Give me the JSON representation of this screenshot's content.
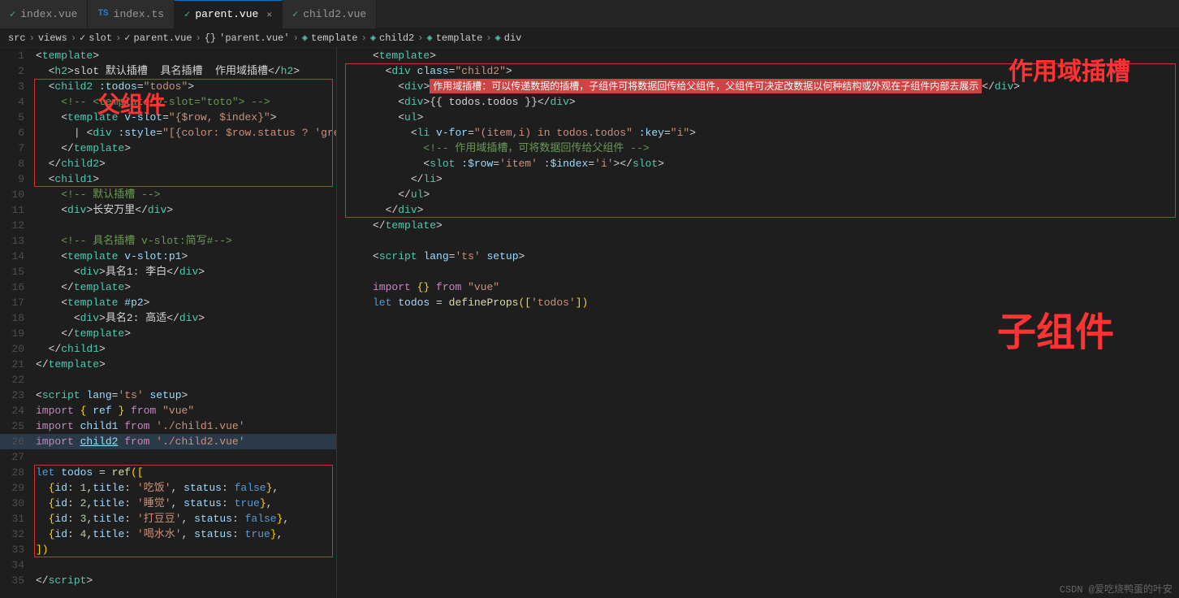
{
  "tabs": [
    {
      "id": "index-vue",
      "label": "index.vue",
      "type": "vue",
      "active": false
    },
    {
      "id": "index-ts",
      "label": "index.ts",
      "type": "ts",
      "active": false
    },
    {
      "id": "parent-vue",
      "label": "parent.vue",
      "type": "vue",
      "active": true
    },
    {
      "id": "child2-vue",
      "label": "child2.vue",
      "type": "vue",
      "active": false
    }
  ],
  "breadcrumb": "src > views > slot > parent.vue > {} 'parent.vue' > template > child2 > template > div",
  "annotations": {
    "father": "父组件",
    "slot": "作用域插槽",
    "child": "子组件"
  },
  "watermark": "CSDN @爱吃烧鸭蛋的叶安"
}
